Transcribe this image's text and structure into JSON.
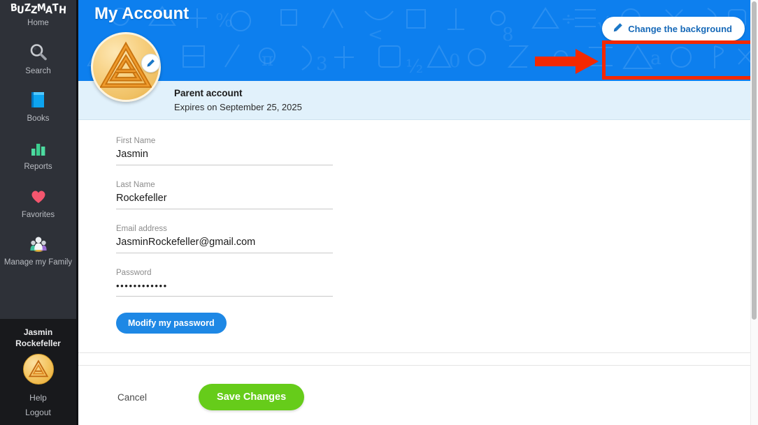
{
  "sidebar": {
    "brand": "BUZZMATH",
    "items": [
      {
        "label": "Home",
        "icon": "home-icon"
      },
      {
        "label": "Search",
        "icon": "search-icon"
      },
      {
        "label": "Books",
        "icon": "book-icon"
      },
      {
        "label": "Reports",
        "icon": "bar-chart-icon"
      },
      {
        "label": "Favorites",
        "icon": "heart-icon"
      },
      {
        "label": "Manage my Family",
        "icon": "family-group-icon"
      }
    ],
    "footer": {
      "user_name_line1": "Jasmin",
      "user_name_line2": "Rockefeller",
      "avatar_icon": "buzzmath-triangle-avatar",
      "help_label": "Help",
      "logout_label": "Logout"
    }
  },
  "header": {
    "title": "My Account",
    "change_background_label": "Change the background",
    "change_background_icon": "pencil-icon",
    "edit_avatar_icon": "pencil-icon",
    "account_type": "Parent account",
    "expiry": "Expires on September 25, 2025"
  },
  "form": {
    "fields": [
      {
        "label": "First Name",
        "value": "Jasmin",
        "type": "text"
      },
      {
        "label": "Last Name",
        "value": "Rockefeller",
        "type": "text"
      },
      {
        "label": "Email address",
        "value": "JasminRockefeller@gmail.com",
        "type": "text"
      },
      {
        "label": "Password",
        "value": "••••••••••••",
        "type": "password"
      }
    ],
    "modify_password_label": "Modify my password"
  },
  "actions": {
    "cancel_label": "Cancel",
    "save_label": "Save Changes"
  },
  "annotation": {
    "highlight_target": "Change the background",
    "color": "#f42800",
    "shapes": [
      "arrow-right",
      "rectangle-outline"
    ]
  },
  "colors": {
    "banner_blue": "#0d7fee",
    "subbar_blue": "#e1f1fb",
    "sidebar_dark": "#2e3138",
    "sidebar_footer_dark": "#18191c",
    "primary_button_blue": "#1e88e5",
    "save_green": "#66cc1a",
    "annotation_red": "#f42800"
  }
}
